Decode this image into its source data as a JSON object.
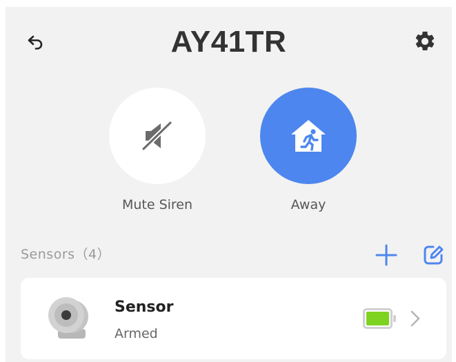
{
  "header": {
    "title": "AY41TR",
    "back_icon": "back-arrow-icon",
    "settings_icon": "gear-icon"
  },
  "modes": {
    "mute": {
      "label": "Mute Siren",
      "icon": "speaker-muted-icon"
    },
    "away": {
      "label": "Away",
      "icon": "house-running-person-icon"
    }
  },
  "sensors": {
    "heading": "Sensors（4）",
    "add_icon": "plus-icon",
    "edit_icon": "edit-icon",
    "items": [
      {
        "name": "Sensor",
        "status": "Armed",
        "icon": "motion-sensor-icon",
        "battery_icon": "battery-full-icon",
        "battery_level": 1.0
      }
    ]
  },
  "colors": {
    "background": "#f2f2f2",
    "accent": "#4d86ee",
    "battery": "#7ed321",
    "title": "#333333"
  }
}
